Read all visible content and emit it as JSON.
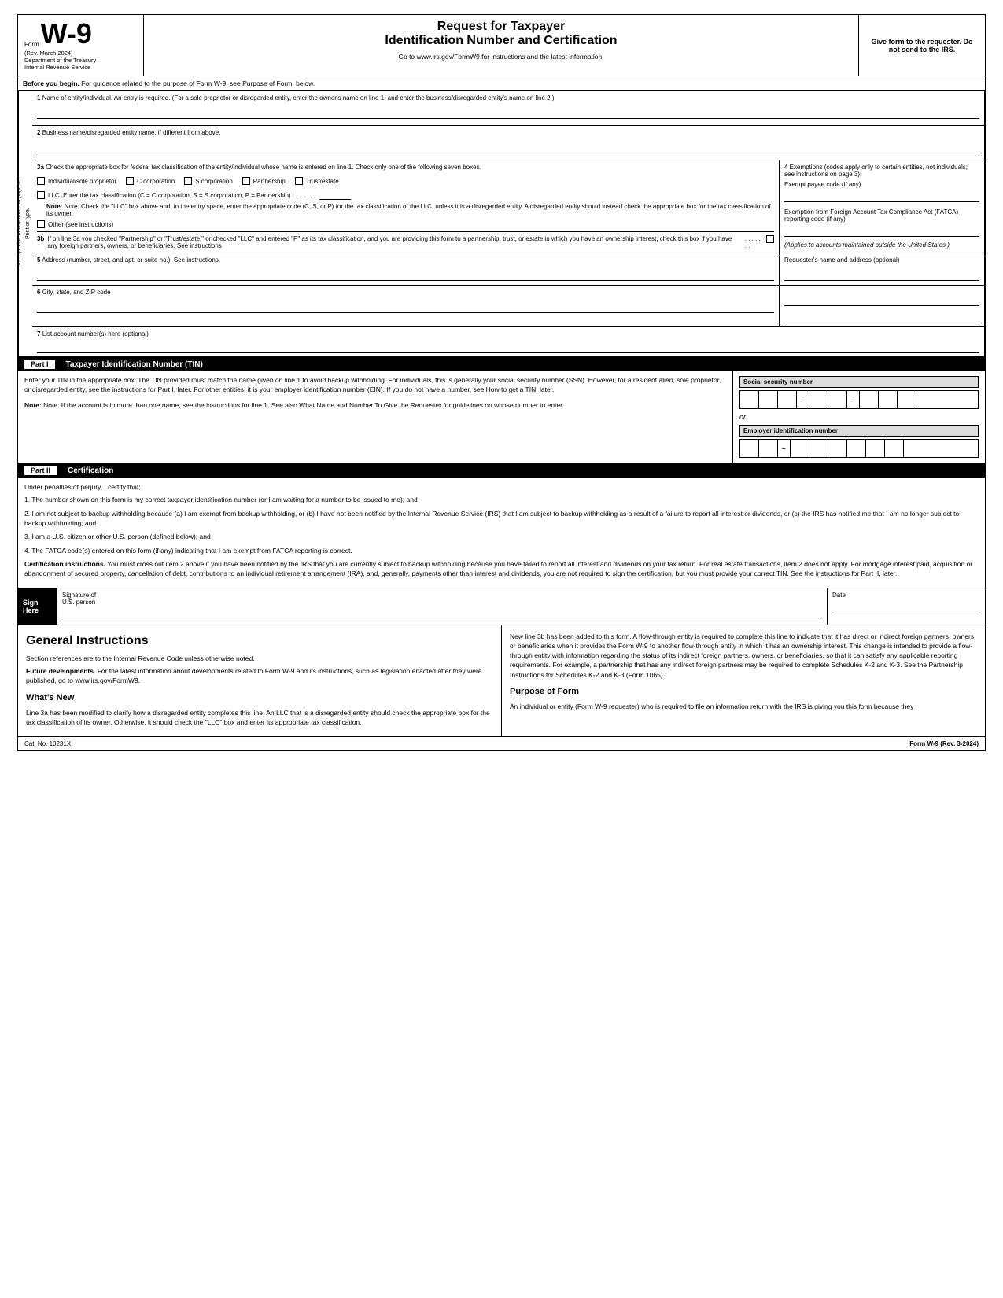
{
  "header": {
    "form_label": "Form",
    "form_name": "W-9",
    "rev": "(Rev. March 2024)",
    "dept": "Department of the Treasury",
    "irs": "Internal Revenue Service",
    "title_main": "Request for Taxpayer",
    "title_sub": "Identification Number and Certification",
    "url_text": "Go to www.irs.gov/FormW9 for instructions and the latest information.",
    "give_form": "Give form to the requester. Do not send to the IRS."
  },
  "before_begin": {
    "label": "Before you begin.",
    "text": "For guidance related to the purpose of Form W-9, see Purpose of Form, below."
  },
  "fields": {
    "field1_num": "1",
    "field1_label": "Name of entity/individual. An entry is required. (For a sole proprietor or disregarded entity, enter the owner's name on line 1, and enter the business/disregarded entity's name on line 2.)",
    "field2_num": "2",
    "field2_label": "Business name/disregarded entity name, if different from above.",
    "field3a_num": "3a",
    "field3a_label": "Check the appropriate box for federal tax classification of the entity/individual whose name is entered on line 1. Check only one of the following seven boxes.",
    "cb1_label": "Individual/sole proprietor",
    "cb2_label": "C corporation",
    "cb3_label": "S corporation",
    "cb4_label": "Partnership",
    "cb5_label": "Trust/estate",
    "cb6_label": "LLC. Enter the tax classification (C = C corporation, S = S corporation, P = Partnership)",
    "llc_dots": ". . . . .",
    "note_3a": "Note: Check the \"LLC\" box above and, in the entry space, enter the appropriate code (C, S, or P) for the tax classification of the LLC, unless it is a disregarded entity. A disregarded entity should instead check the appropriate box for the tax classification of its owner.",
    "cb7_label": "Other (see instructions)",
    "field4_label": "4 Exemptions (codes apply only to certain entities, not individuals; see instructions on page 3):",
    "exempt_payee": "Exempt payee code (if any)",
    "fatca_label": "Exemption from Foreign Account Tax Compliance Act (FATCA) reporting code (if any)",
    "applies": "(Applies to accounts maintained outside the United States.)",
    "field3b_num": "3b",
    "field3b_text": "If on line 3a you checked \"Partnership\" or \"Trust/estate,\" or checked \"LLC\" and entered \"P\" as its tax classification, and you are providing this form to a partnership, trust, or estate in which you have an ownership interest, check this box if you have any foreign partners, owners, or beneficiaries. See instructions",
    "field3b_dots": ". . . . . . .",
    "field5_num": "5",
    "field5_label": "Address (number, street, and apt. or suite no.). See instructions.",
    "requester_label": "Requester's name and address (optional)",
    "field6_num": "6",
    "field6_label": "City, state, and ZIP code",
    "field7_num": "7",
    "field7_label": "List account number(s) here (optional)"
  },
  "sidebar": {
    "line1": "See Specific Instructions on page 3.",
    "line2": "Print or type."
  },
  "part1": {
    "label": "Part I",
    "title": "Taxpayer Identification Number (TIN)",
    "intro": "Enter your TIN in the appropriate box. The TIN provided must match the name given on line 1 to avoid backup withholding. For individuals, this is generally your social security number (SSN). However, for a resident alien, sole proprietor, or disregarded entity, see the instructions for Part I, later. For other entities, it is your employer identification number (EIN). If you do not have a number, see How to get a TIN, later.",
    "note": "Note: If the account is in more than one name, see the instructions for line 1. See also What Name and Number To Give the Requester for guidelines on whose number to enter.",
    "ssn_label": "Social security number",
    "or_text": "or",
    "ein_label": "Employer identification number"
  },
  "part2": {
    "label": "Part II",
    "title": "Certification",
    "under_penalties": "Under penalties of perjury, I certify that:",
    "item1": "1. The number shown on this form is my correct taxpayer identification number (or I am waiting for a number to be issued to me); and",
    "item2": "2. I am not subject to backup withholding because (a) I am exempt from backup withholding, or (b) I have not been notified by the Internal Revenue Service (IRS) that I am subject to backup withholding as a result of a failure to report all interest or dividends, or (c) the IRS has notified me that I am no longer subject to backup withholding; and",
    "item3": "3. I am a U.S. citizen or other U.S. person (defined below); and",
    "item4": "4. The FATCA code(s) entered on this form (if any) indicating that I am exempt from FATCA reporting is correct.",
    "cert_instructions_label": "Certification instructions.",
    "cert_instructions": "You must cross out item 2 above if you have been notified by the IRS that you are currently subject to backup withholding because you have failed to report all interest and dividends on your tax return. For real estate transactions, item 2 does not apply. For mortgage interest paid, acquisition or abandonment of secured property, cancellation of debt, contributions to an individual retirement arrangement (IRA), and, generally, payments other than interest and dividends, you are not required to sign the certification, but you must provide your correct TIN. See the instructions for Part II, later.",
    "sign_label1": "Sign",
    "sign_label2": "Here",
    "signature_of": "Signature of",
    "us_person": "U.S. person",
    "date_label": "Date"
  },
  "general_instructions": {
    "title": "General Instructions",
    "para1": "Section references are to the Internal Revenue Code unless otherwise noted.",
    "future_label": "Future developments.",
    "future_text": "For the latest information about developments related to Form W-9 and its instructions, such as legislation enacted after they were published, go to www.irs.gov/FormW9.",
    "whats_new_title": "What's New",
    "whats_new_text": "Line 3a has been modified to clarify how a disregarded entity completes this line. An LLC that is a disregarded entity should check the appropriate box for the tax classification of its owner. Otherwise, it should check the \"LLC\" box and enter its appropriate tax classification.",
    "right_para": "New line 3b has been added to this form. A flow-through entity is required to complete this line to indicate that it has direct or indirect foreign partners, owners, or beneficiaries when it provides the Form W-9 to another flow-through entity in which it has an ownership interest. This change is intended to provide a flow-through entity with information regarding the status of its indirect foreign partners, owners, or beneficiaries, so that it can satisfy any applicable reporting requirements. For example, a partnership that has any indirect foreign partners may be required to complete Schedules K-2 and K-3. See the Partnership Instructions for Schedules K-2 and K-3 (Form 1065).",
    "purpose_title": "Purpose of Form",
    "purpose_text": "An individual or entity (Form W-9 requester) who is required to file an information return with the IRS is giving you this form because they"
  },
  "footer": {
    "cat_no": "Cat. No. 10231X",
    "form_ref": "Form W-9 (Rev. 3-2024)"
  }
}
